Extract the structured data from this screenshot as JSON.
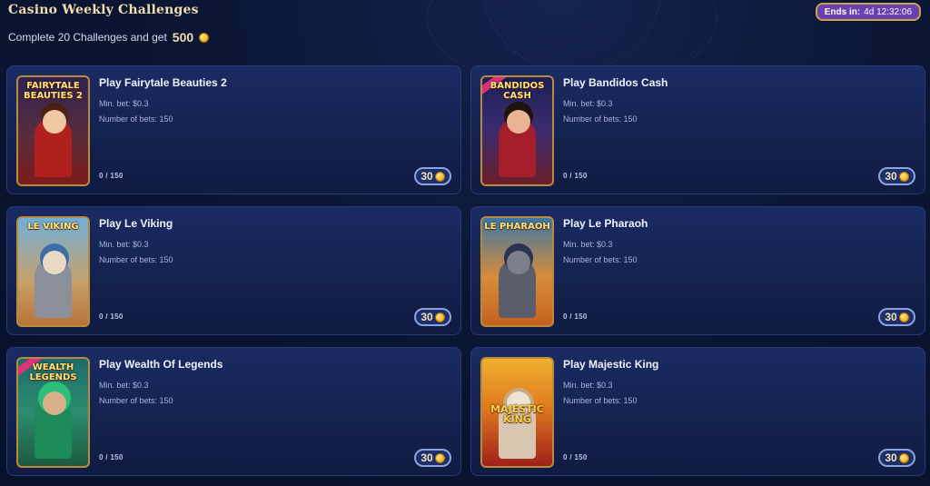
{
  "header": {
    "title": "Casino Weekly Challenges",
    "subtitle": "Complete 20 Challenges and get",
    "reward_amount": "500",
    "ends_label": "Ends in:",
    "ends_value": "4d 12:32:06"
  },
  "challenges": [
    {
      "title": "Play Fairytale Beauties 2",
      "thumb_text": "FAIRYTALE BEAUTIES 2",
      "min_bet": "Min. bet: $0.3",
      "num_bets": "Number of bets: 150",
      "progress": "0 / 150",
      "reward": "30"
    },
    {
      "title": "Play Bandidos Cash",
      "thumb_text": "BANDIDOS CASH",
      "min_bet": "Min. bet: $0.3",
      "num_bets": "Number of bets: 150",
      "progress": "0 / 150",
      "reward": "30"
    },
    {
      "title": "Play Le Viking",
      "thumb_text": "LE VIKING",
      "min_bet": "Min. bet: $0.3",
      "num_bets": "Number of bets: 150",
      "progress": "0 / 150",
      "reward": "30"
    },
    {
      "title": "Play Le Pharaoh",
      "thumb_text": "LE PHARAOH",
      "min_bet": "Min. bet: $0.3",
      "num_bets": "Number of bets: 150",
      "progress": "0 / 150",
      "reward": "30"
    },
    {
      "title": "Play Wealth Of Legends",
      "thumb_text": "WEALTH LEGENDS",
      "min_bet": "Min. bet: $0.3",
      "num_bets": "Number of bets: 150",
      "progress": "0 / 150",
      "reward": "30"
    },
    {
      "title": "Play Majestic King",
      "thumb_text": "MAJESTIC KING",
      "min_bet": "Min. bet: $0.3",
      "num_bets": "Number of bets: 150",
      "progress": "0 / 150",
      "reward": "30"
    }
  ],
  "colors": {
    "background": "#0a1330",
    "card": "#1a2b63",
    "gold_text": "#f1dcb0",
    "badge": "#6a3fb0"
  },
  "icons": {
    "coin": "coin-icon"
  }
}
